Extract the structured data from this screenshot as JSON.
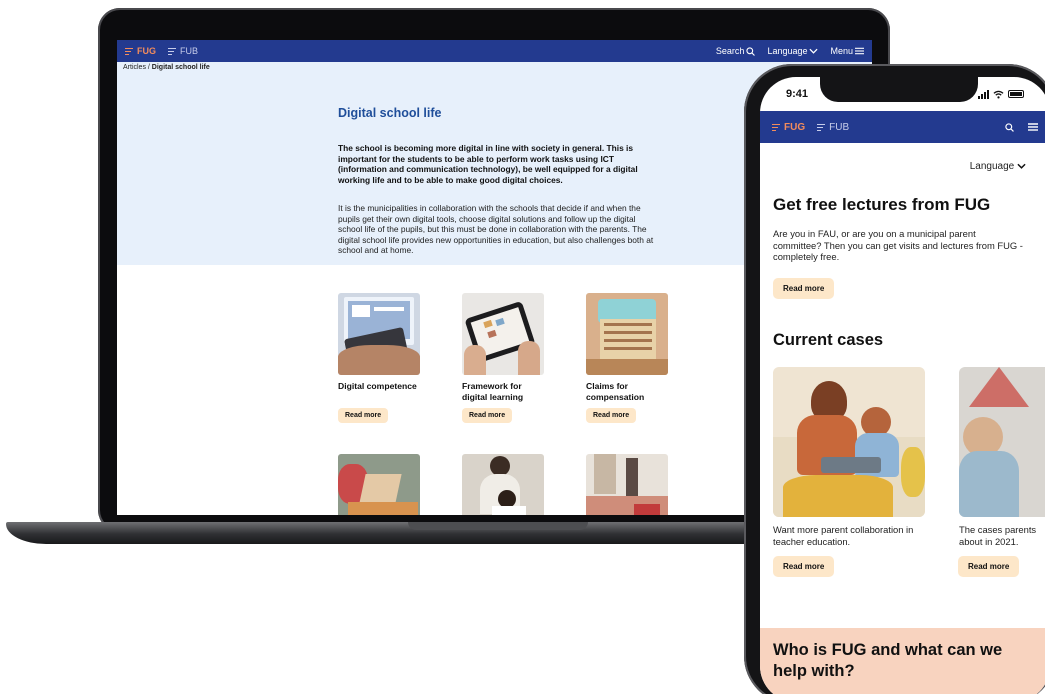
{
  "laptop": {
    "nav": {
      "brand_active": "FUG",
      "brand_inactive": "FUB",
      "search": "Search",
      "language": "Language",
      "menu": "Menu"
    },
    "breadcrumb": {
      "root": "Articles",
      "sep": " / ",
      "current": "Digital school life"
    },
    "title": "Digital school life",
    "lead": "The school is becoming more digital in line with society in general. This is important for the students to be able to perform work tasks using ICT (information and communication technology), be well equipped for a digital working life and to be able to make good digital choices.",
    "body": "It is the municipalities in collaboration with the schools that decide if and when the pupils get their own digital tools, choose digital solutions and follow up the digital school life of the pupils, but this must be done in collaboration with the parents. The digital school life provides new opportunities in education, but also challenges both at school and at home.",
    "cards": [
      {
        "title": "Digital competence",
        "button": "Read more"
      },
      {
        "title": "Framework for digital learning",
        "button": "Read more"
      },
      {
        "title": "Claims for compensation",
        "button": "Read more"
      }
    ]
  },
  "phone": {
    "time": "9:41",
    "nav": {
      "brand_active": "FUG",
      "brand_inactive": "FUB"
    },
    "language": "Language",
    "heading": "Get free lectures from FUG",
    "intro": "Are you in FAU, or are you on a municipal parent committee? Then you can get visits and lectures from FUG - completely free.",
    "read_more": "Read more",
    "cases_heading": "Current cases",
    "cases": [
      {
        "caption": "Want more parent collaboration in teacher education.",
        "button": "Read more"
      },
      {
        "caption": "The cases parents about in 2021.",
        "button": "Read more"
      }
    ],
    "who_heading": "Who is FUG and what can we help with?"
  },
  "colors": {
    "nav_blue": "#233a8f",
    "brand_orange": "#f28c5c",
    "hero_bg": "#e7f0fb",
    "title_blue": "#1f4e9a",
    "pill_bg": "#fde7c9",
    "who_bg": "#f8d3bf"
  }
}
